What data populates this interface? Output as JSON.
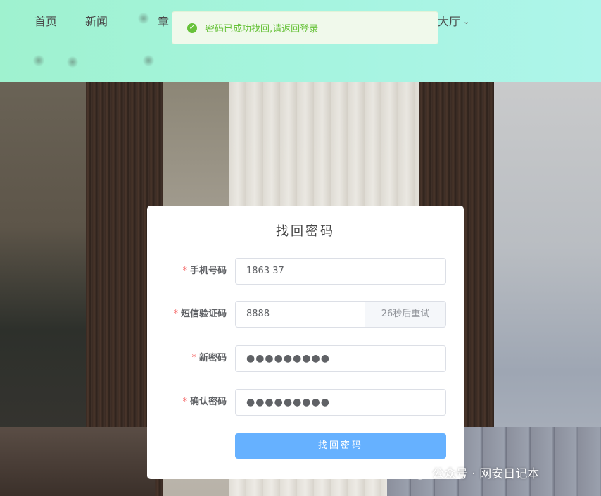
{
  "nav": {
    "items": [
      {
        "label": "首页"
      },
      {
        "label": "新闻"
      },
      {
        "label": "章"
      },
      {
        "label": "大厅"
      }
    ]
  },
  "toast": {
    "message": "密码已成功找回,请返回登录",
    "icon": "check-circle-icon",
    "color": "#67c23a"
  },
  "form": {
    "title": "找回密码",
    "phone": {
      "label": "手机号码",
      "value": "1863  37"
    },
    "sms": {
      "label": "短信验证码",
      "value": "8888",
      "countdown": "26秒后重试"
    },
    "new_password": {
      "label": "新密码",
      "value": "●●●●●●●●●"
    },
    "confirm_password": {
      "label": "确认密码",
      "value": "●●●●●●●●●"
    },
    "required_mark": "*",
    "submit_label": "找回密码"
  },
  "watermark": {
    "text": "公众号 · 网安日记本",
    "icon": "wechat-icon"
  },
  "colors": {
    "primary_button": "#66b1ff",
    "required": "#f56c6c",
    "toast_bg": "#f0f9eb"
  }
}
